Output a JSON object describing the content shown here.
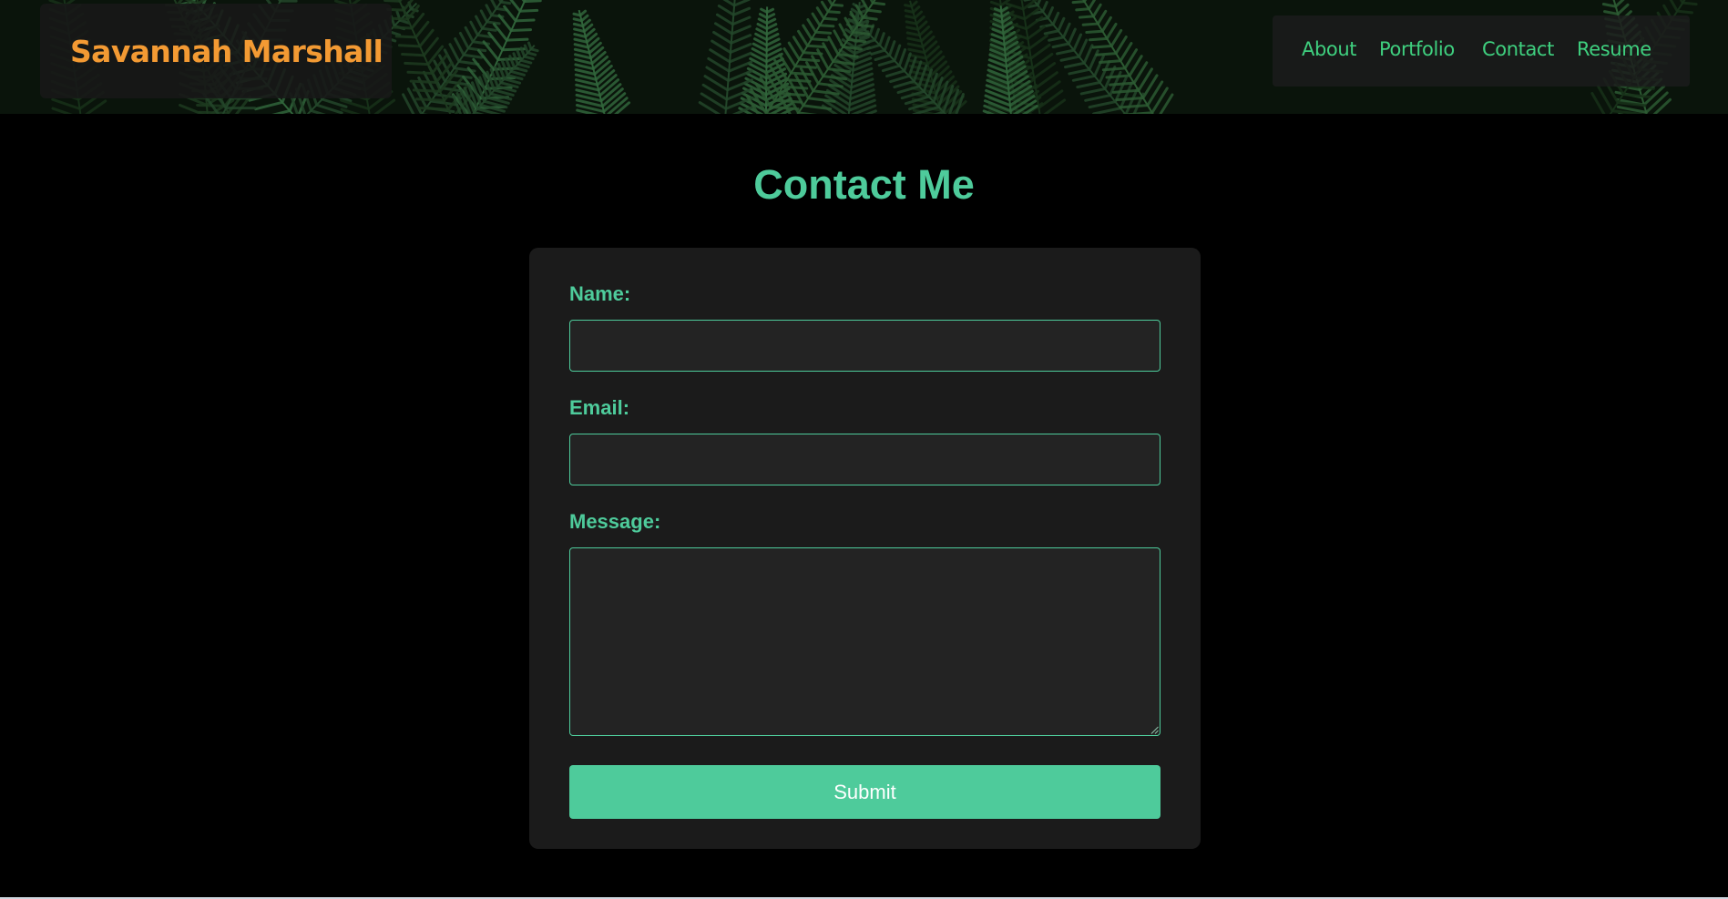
{
  "header": {
    "brand_name": "Savannah Marshall",
    "nav": {
      "about": "About",
      "portfolio": "Portfolio",
      "contact": "Contact",
      "resume": "Resume"
    }
  },
  "main": {
    "title": "Contact Me",
    "form": {
      "name_label": "Name:",
      "name_value": "",
      "email_label": "Email:",
      "email_value": "",
      "message_label": "Message:",
      "message_value": "",
      "submit_label": "Submit"
    }
  },
  "colors": {
    "page_background": "#000000",
    "brand": "#f39a33",
    "nav_link": "#3fd07f",
    "accent": "#4ecb9b",
    "card_background": "#1b1b1b",
    "input_background": "#232323"
  },
  "icons": {
    "header_background": "fern-leaves-image",
    "textarea_resize": "resize-grip-icon"
  }
}
